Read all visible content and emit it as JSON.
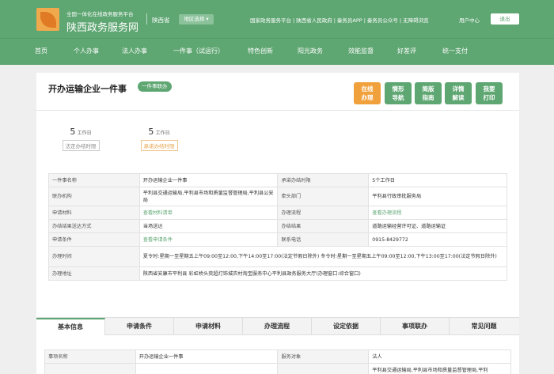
{
  "header": {
    "brand_sub": "全国一体化在线政务服务平台",
    "brand_main": "陕西政务服务网",
    "province": "陕西省",
    "region_select": "地区选择 ▾",
    "links": [
      "国家政务服务平台",
      "陕西省人民政府",
      "秦务员APP",
      "秦务员公众号",
      "无障碍浏览"
    ],
    "user_center": "用户中心",
    "logout": "退出"
  },
  "nav": [
    "首页",
    "个人办事",
    "法人办事",
    "一件事（试运行）",
    "特色创新",
    "阳光政务",
    "效能监督",
    "好差评",
    "统一支付"
  ],
  "page": {
    "title": "开办运输企业一件事",
    "badge": "一件事联办",
    "actions": [
      {
        "label1": "在线",
        "label2": "办理",
        "color": "orange"
      },
      {
        "label1": "情形",
        "label2": "导航",
        "color": "green"
      },
      {
        "label1": "简版",
        "label2": "指南",
        "color": "green"
      },
      {
        "label1": "详情",
        "label2": "解读",
        "color": "green"
      },
      {
        "label1": "我要",
        "label2": "打印",
        "color": "green"
      }
    ],
    "legal_limit": {
      "num": "5",
      "unit": "工作日",
      "label": "法定办结时限"
    },
    "promise_limit": {
      "num": "5",
      "unit": "工作日",
      "label": "承诺办结时限"
    }
  },
  "info": {
    "name_k": "一件事名称",
    "name_v": "开办运输企业一件事",
    "promise_k": "承诺办结时限",
    "promise_v": "5个工作日",
    "org_k": "联办机构",
    "org_v": "平利县交通运输局,平利县市场和质量监督管理局,平利县公安局",
    "lead_k": "牵头部门",
    "lead_v": "平利县行政审批服务局",
    "material_k": "申请材料",
    "material_v": "查看材料清单",
    "process_k": "办理流程",
    "process_v": "查看办理流程",
    "delivery_k": "办结结果送达方式",
    "delivery_v": "当场送达",
    "result_k": "办结结果",
    "result_v": "道路运输经营许可证、道路运输证",
    "cond_k": "申请条件",
    "cond_v": "查看申请条件",
    "phone_k": "联系电话",
    "phone_v": "0915-8429772",
    "time_k": "办理时间",
    "time_v": "夏令时:星期一至星期五上午09:00至12:00,下午14:00至17:00(法定节假日除外) 冬令时:星期一至星期五上午09:00至12:00,下午13:00至17:00(法定节假日除外)",
    "addr_k": "办理地址",
    "addr_v": "陕西省安康市平利县 彩虹桥头奕超灯饰城农村淘宝服务中心平利县政务服务大厅(办理窗口:综合窗口)"
  },
  "tabs": [
    "基本信息",
    "申请条件",
    "申请材料",
    "办理流程",
    "设定依据",
    "事项联办",
    "常见问题"
  ],
  "basic": {
    "name_k": "事项名称",
    "name_v": "开办运输企业一件事",
    "target_k": "服务对象",
    "target_v": "法人",
    "row2_v": "平利县交通运输局,平利县市场和质量监督管理局,平利"
  },
  "colors": {
    "brand_green": "#5ea672",
    "accent_orange": "#f1a13c"
  }
}
